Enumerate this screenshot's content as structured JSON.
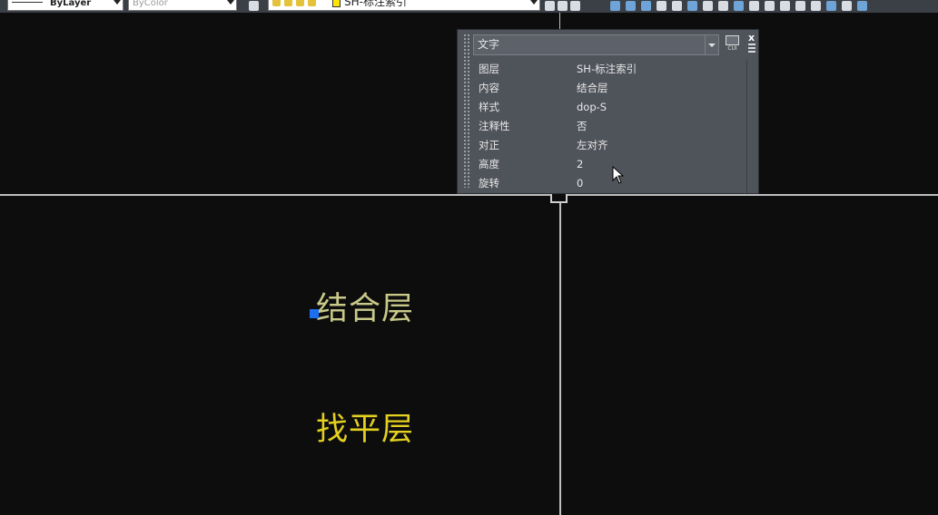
{
  "toolbar": {
    "linetype": "ByLayer",
    "color": "ByColor",
    "layer": "SH-标注索引"
  },
  "canvas": {
    "text_1": "结合层",
    "text_2": "找平层"
  },
  "quick_properties": {
    "object_type": "文字",
    "cui_label": "CUI",
    "close_label": "x",
    "rows": [
      {
        "key": "图层",
        "value": "SH-标注索引"
      },
      {
        "key": "内容",
        "value": "结合层"
      },
      {
        "key": "样式",
        "value": "dop-S"
      },
      {
        "key": "注释性",
        "value": "否"
      },
      {
        "key": "对正",
        "value": "左对齐"
      },
      {
        "key": "高度",
        "value": "2"
      },
      {
        "key": "旋转",
        "value": "0"
      }
    ]
  },
  "colors": {
    "canvas_bg": "#0d0d0d",
    "text_combined": "#c9c98a",
    "text_leveling": "#e3d01f",
    "grip": "#1e6ff0",
    "panel_bg": "#4f535a"
  }
}
